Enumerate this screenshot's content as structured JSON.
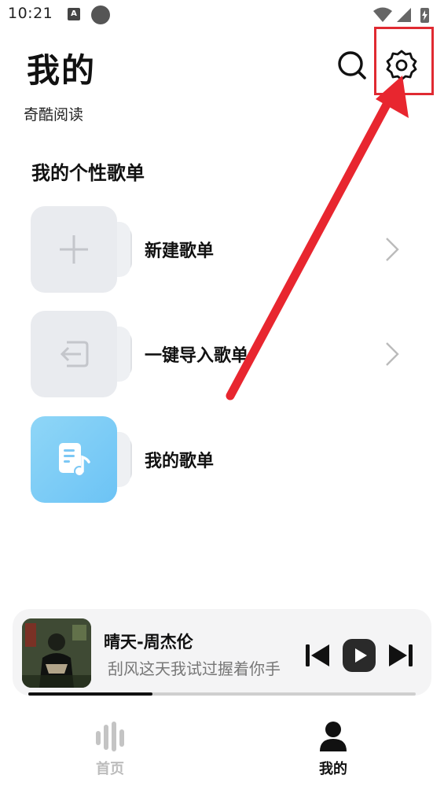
{
  "status_bar": {
    "time": "10:21",
    "icons": [
      "notification-a-icon",
      "circle-icon",
      "wifi-icon",
      "signal-icon",
      "battery-icon"
    ]
  },
  "header": {
    "title": "我的",
    "subtitle": "奇酷阅读",
    "icons": [
      "search-icon",
      "gear-icon"
    ]
  },
  "playlists": {
    "section_title": "我的个性歌单",
    "items": [
      {
        "label": "新建歌单",
        "icon": "plus-icon",
        "has_chevron": true
      },
      {
        "label": "一键导入歌单",
        "icon": "import-icon",
        "has_chevron": true
      },
      {
        "label": "我的歌单",
        "icon": "music-note-icon",
        "has_chevron": false
      }
    ]
  },
  "player": {
    "song_title": "晴天-周杰伦",
    "lyric": "刮风这天我试过握着你手",
    "progress_percent": 32
  },
  "tabs": [
    {
      "label": "首页",
      "icon": "audio-bars-icon",
      "active": false
    },
    {
      "label": "我的",
      "icon": "person-icon",
      "active": true
    }
  ],
  "colors": {
    "accent_red": "#e02a32",
    "playlist_blue": "#7ccaf5",
    "tab_inactive": "#bcbcbc",
    "tab_active": "#111111"
  }
}
